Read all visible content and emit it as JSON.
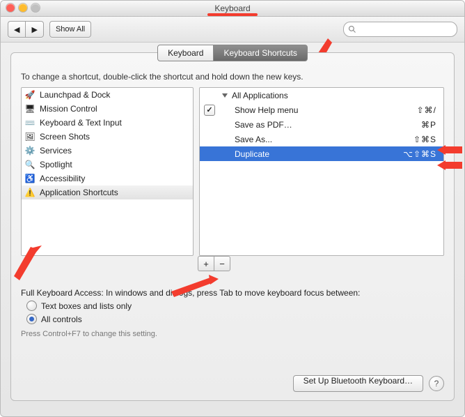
{
  "window": {
    "title": "Keyboard"
  },
  "toolbar": {
    "back": "◀",
    "forward": "▶",
    "show_all": "Show All",
    "search_placeholder": ""
  },
  "tabs": {
    "keyboard": "Keyboard",
    "shortcuts": "Keyboard Shortcuts"
  },
  "instructions": "To change a shortcut, double-click the shortcut and hold down the new keys.",
  "categories": [
    {
      "icon": "🚀",
      "label": "Launchpad & Dock",
      "selected": false
    },
    {
      "icon": "🖥",
      "label": "Mission Control",
      "selected": false
    },
    {
      "icon": "⌨️",
      "label": "Keyboard & Text Input",
      "selected": false
    },
    {
      "icon": "🖼",
      "label": "Screen Shots",
      "selected": false
    },
    {
      "icon": "⚙️",
      "label": "Services",
      "selected": false
    },
    {
      "icon": "🔍",
      "label": "Spotlight",
      "selected": false
    },
    {
      "icon": "♿️",
      "label": "Accessibility",
      "selected": false
    },
    {
      "icon": "⚠️",
      "label": "Application Shortcuts",
      "selected": true
    }
  ],
  "shortcuts": {
    "group": "All Applications",
    "items": [
      {
        "checked": true,
        "name": "Show Help menu",
        "keys": "⇧⌘/",
        "selected": false
      },
      {
        "checked": false,
        "name": "Save as PDF…",
        "keys": "⌘P",
        "selected": false
      },
      {
        "checked": false,
        "name": "Save As...",
        "keys": "⇧⌘S",
        "selected": false
      },
      {
        "checked": false,
        "name": "Duplicate",
        "keys": "⌥⇧⌘S",
        "selected": true
      }
    ]
  },
  "add_label": "+",
  "remove_label": "−",
  "fka_text": "Full Keyboard Access: In windows and dialogs, press Tab to move keyboard focus between:",
  "radio1": "Text boxes and lists only",
  "radio2": "All controls",
  "hint": "Press Control+F7 to change this setting.",
  "bt_button": "Set Up Bluetooth Keyboard…",
  "help": "?"
}
